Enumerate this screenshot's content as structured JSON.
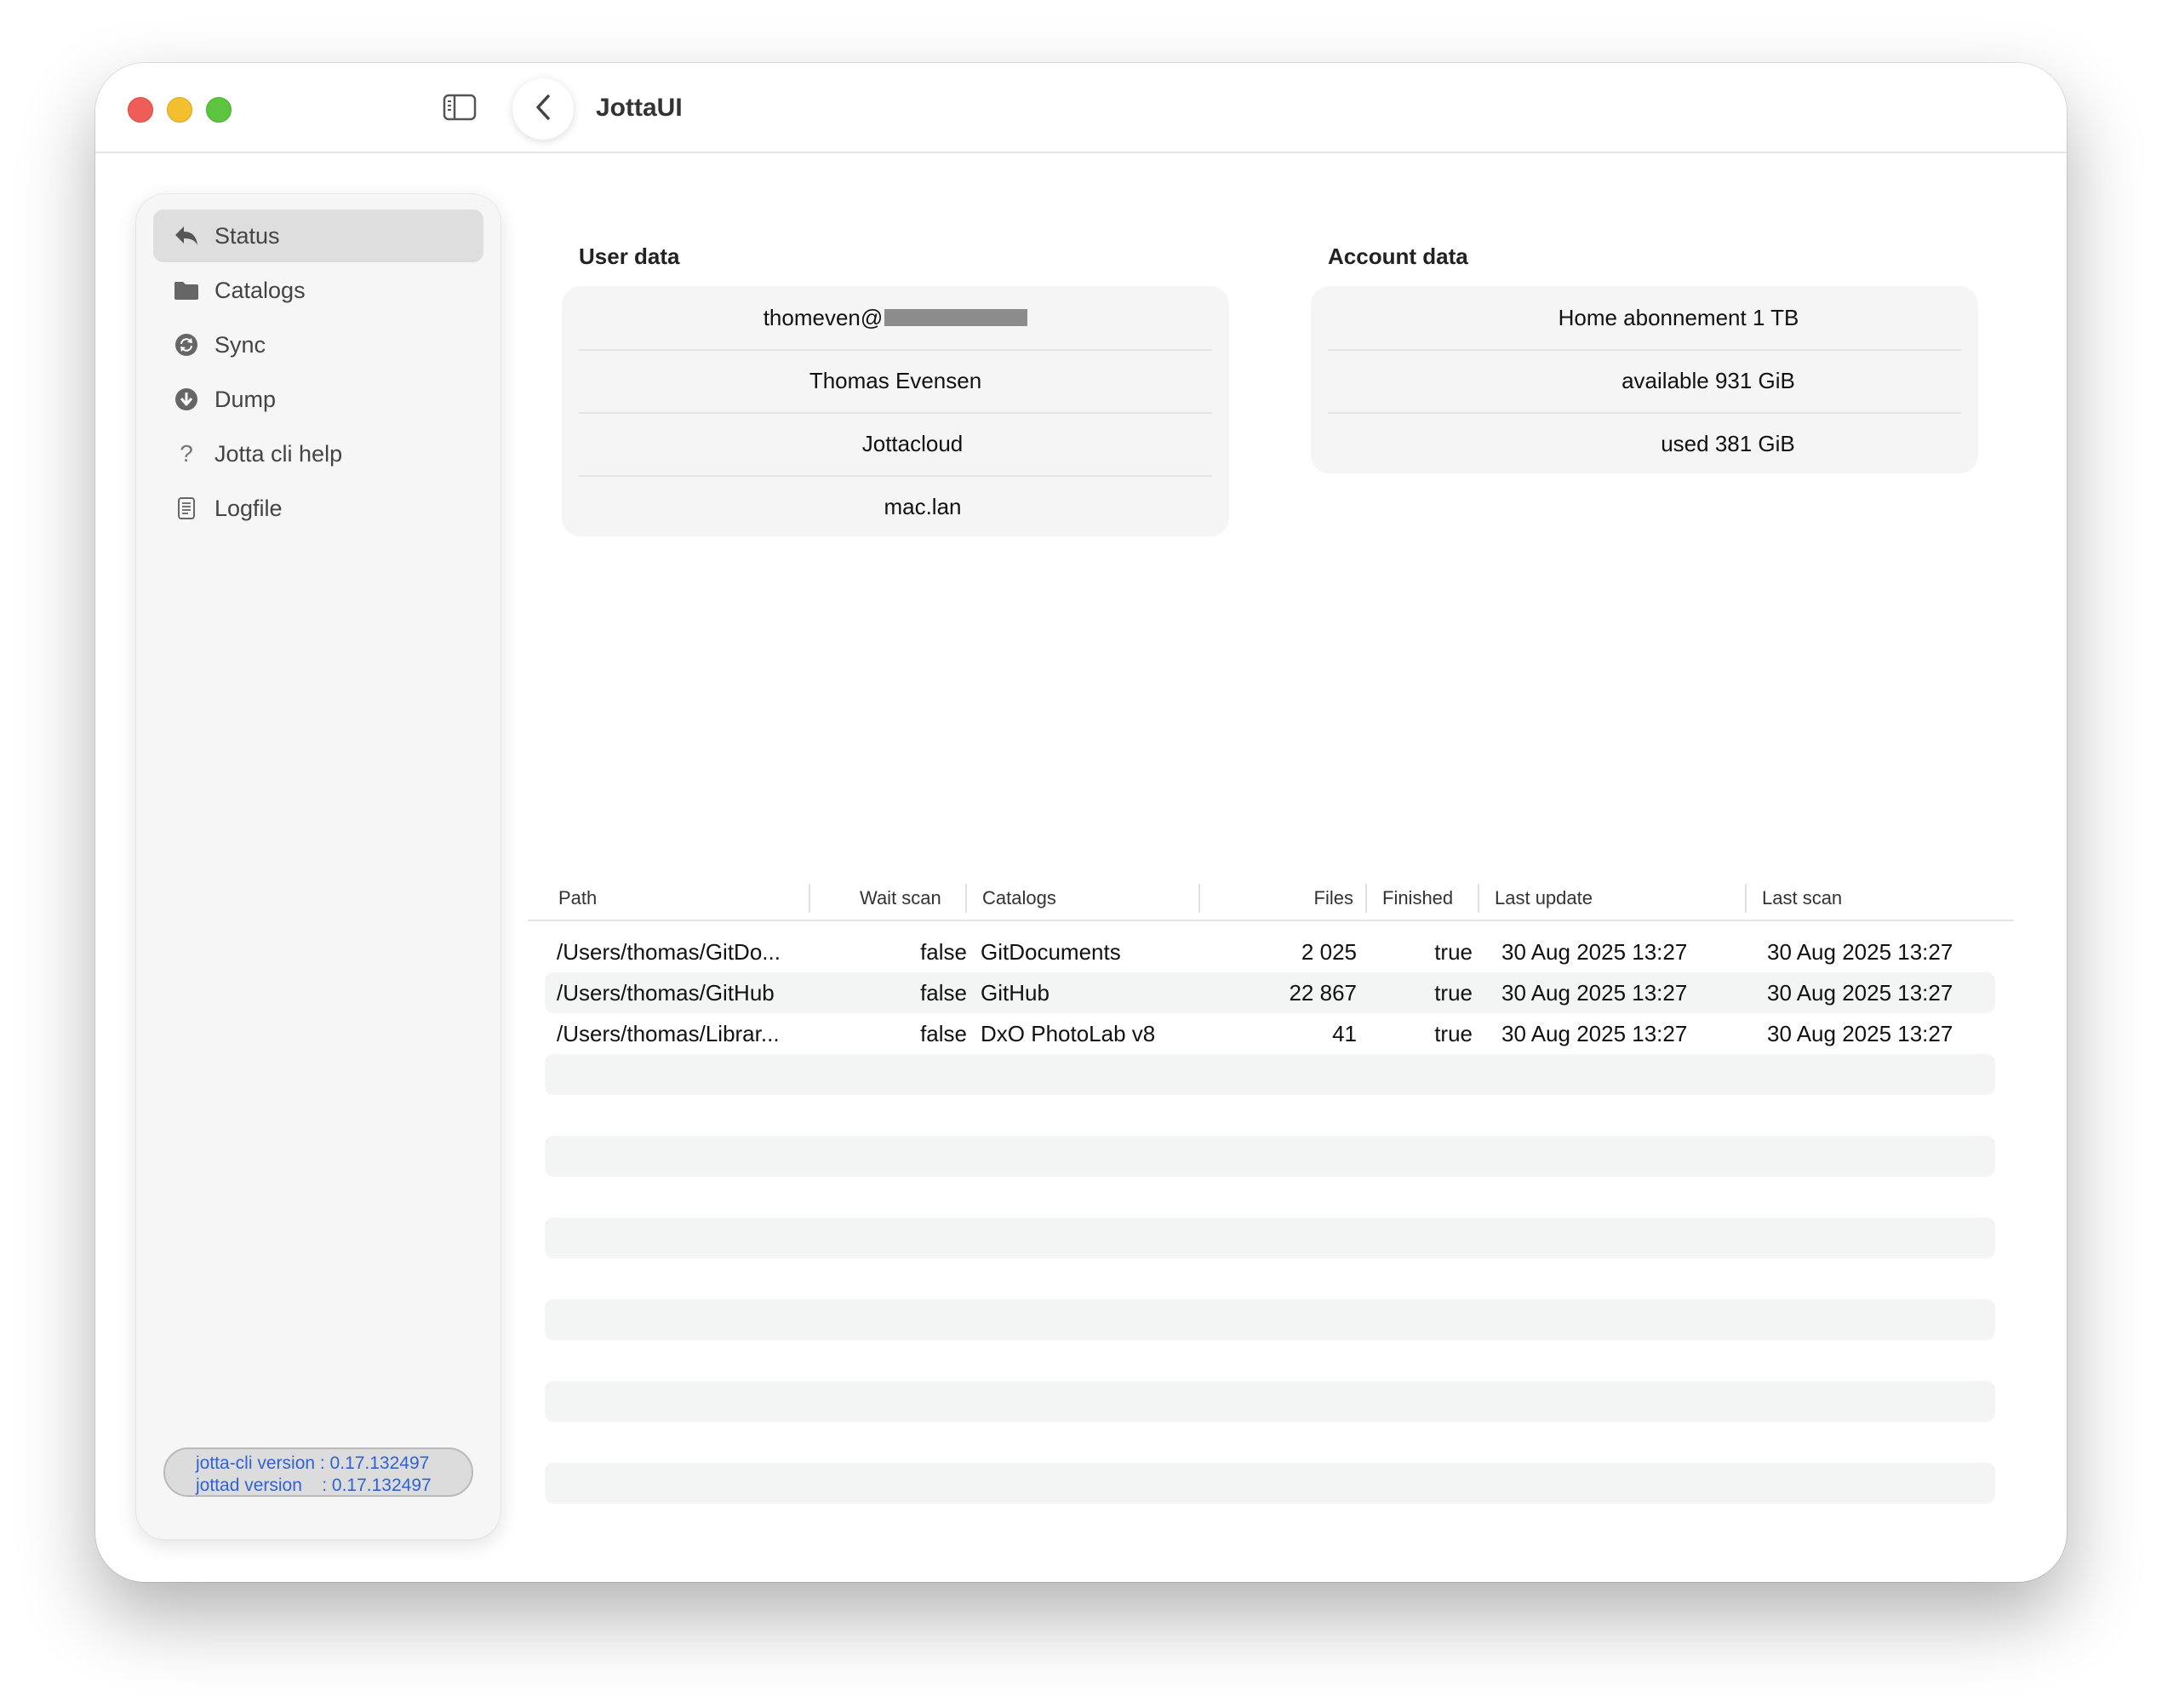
{
  "window": {
    "title": "JottaUI"
  },
  "sidebar": {
    "items": [
      {
        "label": "Status",
        "icon": "back-arrow-icon",
        "selected": true
      },
      {
        "label": "Catalogs",
        "icon": "folder-icon"
      },
      {
        "label": "Sync",
        "icon": "sync-icon"
      },
      {
        "label": "Dump",
        "icon": "download-icon"
      },
      {
        "label": "Jotta cli help",
        "icon": "question-icon"
      },
      {
        "label": "Logfile",
        "icon": "document-icon"
      }
    ],
    "versions": {
      "cli_line": "jotta-cli version : 0.17.132497",
      "daemon_line": "jottad version    : 0.17.132497"
    }
  },
  "user_data": {
    "title": "User data",
    "email_prefix": "thomeven@",
    "name": "Thomas Evensen",
    "service": "Jottacloud",
    "host": "mac.lan"
  },
  "account_data": {
    "title": "Account data",
    "subscription": "Home abonnement 1 TB",
    "available": "available 931 GiB",
    "used": "used 381 GiB"
  },
  "table": {
    "columns": [
      "Path",
      "Wait scan",
      "Catalogs",
      "Files",
      "Finished",
      "Last update",
      "Last scan"
    ],
    "rows": [
      {
        "path": "/Users/thomas/GitDo...",
        "wait_scan": "false",
        "catalog": "GitDocuments",
        "files": "2 025",
        "finished": "true",
        "last_update": "30 Aug 2025 13:27",
        "last_scan": "30 Aug 2025 13:27"
      },
      {
        "path": "/Users/thomas/GitHub",
        "wait_scan": "false",
        "catalog": "GitHub",
        "files": "22 867",
        "finished": "true",
        "last_update": "30 Aug 2025 13:27",
        "last_scan": "30 Aug 2025 13:27"
      },
      {
        "path": "/Users/thomas/Librar...",
        "wait_scan": "false",
        "catalog": "DxO PhotoLab v8",
        "files": "41",
        "finished": "true",
        "last_update": "30 Aug 2025 13:27",
        "last_scan": "30 Aug 2025 13:27"
      }
    ]
  },
  "colors": {
    "close": "#ee5e57",
    "minimize": "#f4bf2f",
    "maximize": "#5cc53f",
    "version_text": "#2f63d2",
    "selected_bg": "#dedede"
  }
}
